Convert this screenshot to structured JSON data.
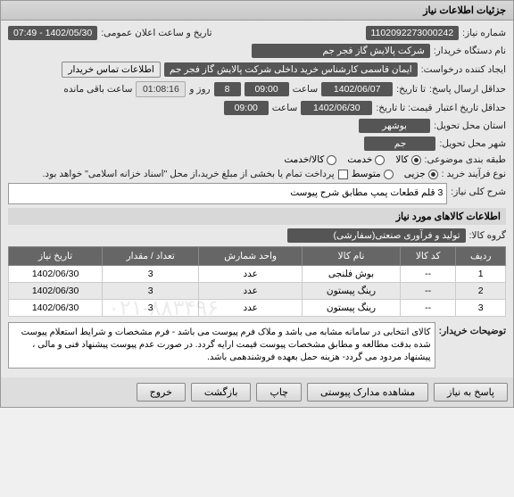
{
  "panel": {
    "title": "جزئیات اطلاعات نیاز"
  },
  "fields": {
    "need_no_label": "شماره نیاز:",
    "need_no": "1102092273000242",
    "announce_label": "تاریخ و ساعت اعلان عمومی:",
    "announce_date": "1402/05/30 - 07:49",
    "buyer_label": "نام دستگاه خریدار:",
    "buyer": "شرکت پالایش گاز فجر جم",
    "creator_label": "ایجاد کننده درخواست:",
    "creator": "ایمان قاسمی کارشناس خرید داخلی شرکت پالایش گاز فجر جم",
    "contact_btn": "اطلاعات تماس خریدار",
    "deadline_label": "حداقل ارسال پاسخ:",
    "deadline_to": "تا تاریخ:",
    "deadline_date": "1402/06/07",
    "time_label": "ساعت",
    "deadline_time": "09:00",
    "day_label": "روز و",
    "days": "8",
    "remain_label": "ساعت باقی مانده",
    "remain_time": "01:08:16",
    "validity_label": "حداقل تاریخ اعتبار",
    "validity_to": "قیمت: تا تاریخ:",
    "validity_date": "1402/06/30",
    "validity_time": "09:00",
    "province_label": "استان محل تحویل:",
    "province": "بوشهر",
    "city_label": "شهر محل تحویل:",
    "city": "جم",
    "category_label": "طبقه بندی موضوعی:",
    "cat_goods": "کالا",
    "cat_service": "خدمت",
    "cat_both": "کالا/خدمت",
    "process_label": "نوع فرآیند خرید :",
    "proc_small": "جزیی",
    "proc_medium": "متوسط",
    "payment_note": "پرداخت تمام یا بخشی از مبلغ خرید،از محل \"اسناد خزانه اسلامی\" خواهد بود.",
    "desc_label": "شرح کلی نیاز:",
    "desc": "3 قلم قطعات پمپ مطابق شرح پیوست"
  },
  "goods": {
    "section_title": "اطلاعات کالاهای مورد نیاز",
    "group_label": "گروه کالا:",
    "group": "تولید و فرآوری صنعتی(سفارشی)",
    "columns": {
      "row": "ردیف",
      "code": "کد کالا",
      "name": "نام کالا",
      "unit": "واحد شمارش",
      "qty": "تعداد / مقدار",
      "date": "تاریخ نیاز"
    },
    "rows": [
      {
        "n": "1",
        "code": "--",
        "name": "بوش فلنجی",
        "unit": "عدد",
        "qty": "3",
        "date": "1402/06/30"
      },
      {
        "n": "2",
        "code": "--",
        "name": "رینگ پیستون",
        "unit": "عدد",
        "qty": "3",
        "date": "1402/06/30"
      },
      {
        "n": "3",
        "code": "--",
        "name": "رینگ پیستون",
        "unit": "عدد",
        "qty": "3",
        "date": "1402/06/30"
      }
    ]
  },
  "buyer_desc": {
    "label": "توضیحات خریدار:",
    "text": "کالای انتخابی در سامانه مشابه می باشد و ملاک فرم پیوست می باشد  -  فرم مشخصات و شرایط استعلام  پیوست شده بدقت مطالعه و مطابق مشخصات پیوست قیمت ارایه گردد. در صورت عدم پیوست پیشنهاد فنی و مالی ، پیشنهاد مردود می گردد-  هزینه حمل بعهده فروشندهمی باشد."
  },
  "footer": {
    "reply": "پاسخ به نیاز",
    "attach": "مشاهده مدارک پیوستی",
    "print": "چاپ",
    "back": "بازگشت",
    "exit": "خروج"
  },
  "watermark": "۰۲۱-۸۸۳۴۹۶"
}
